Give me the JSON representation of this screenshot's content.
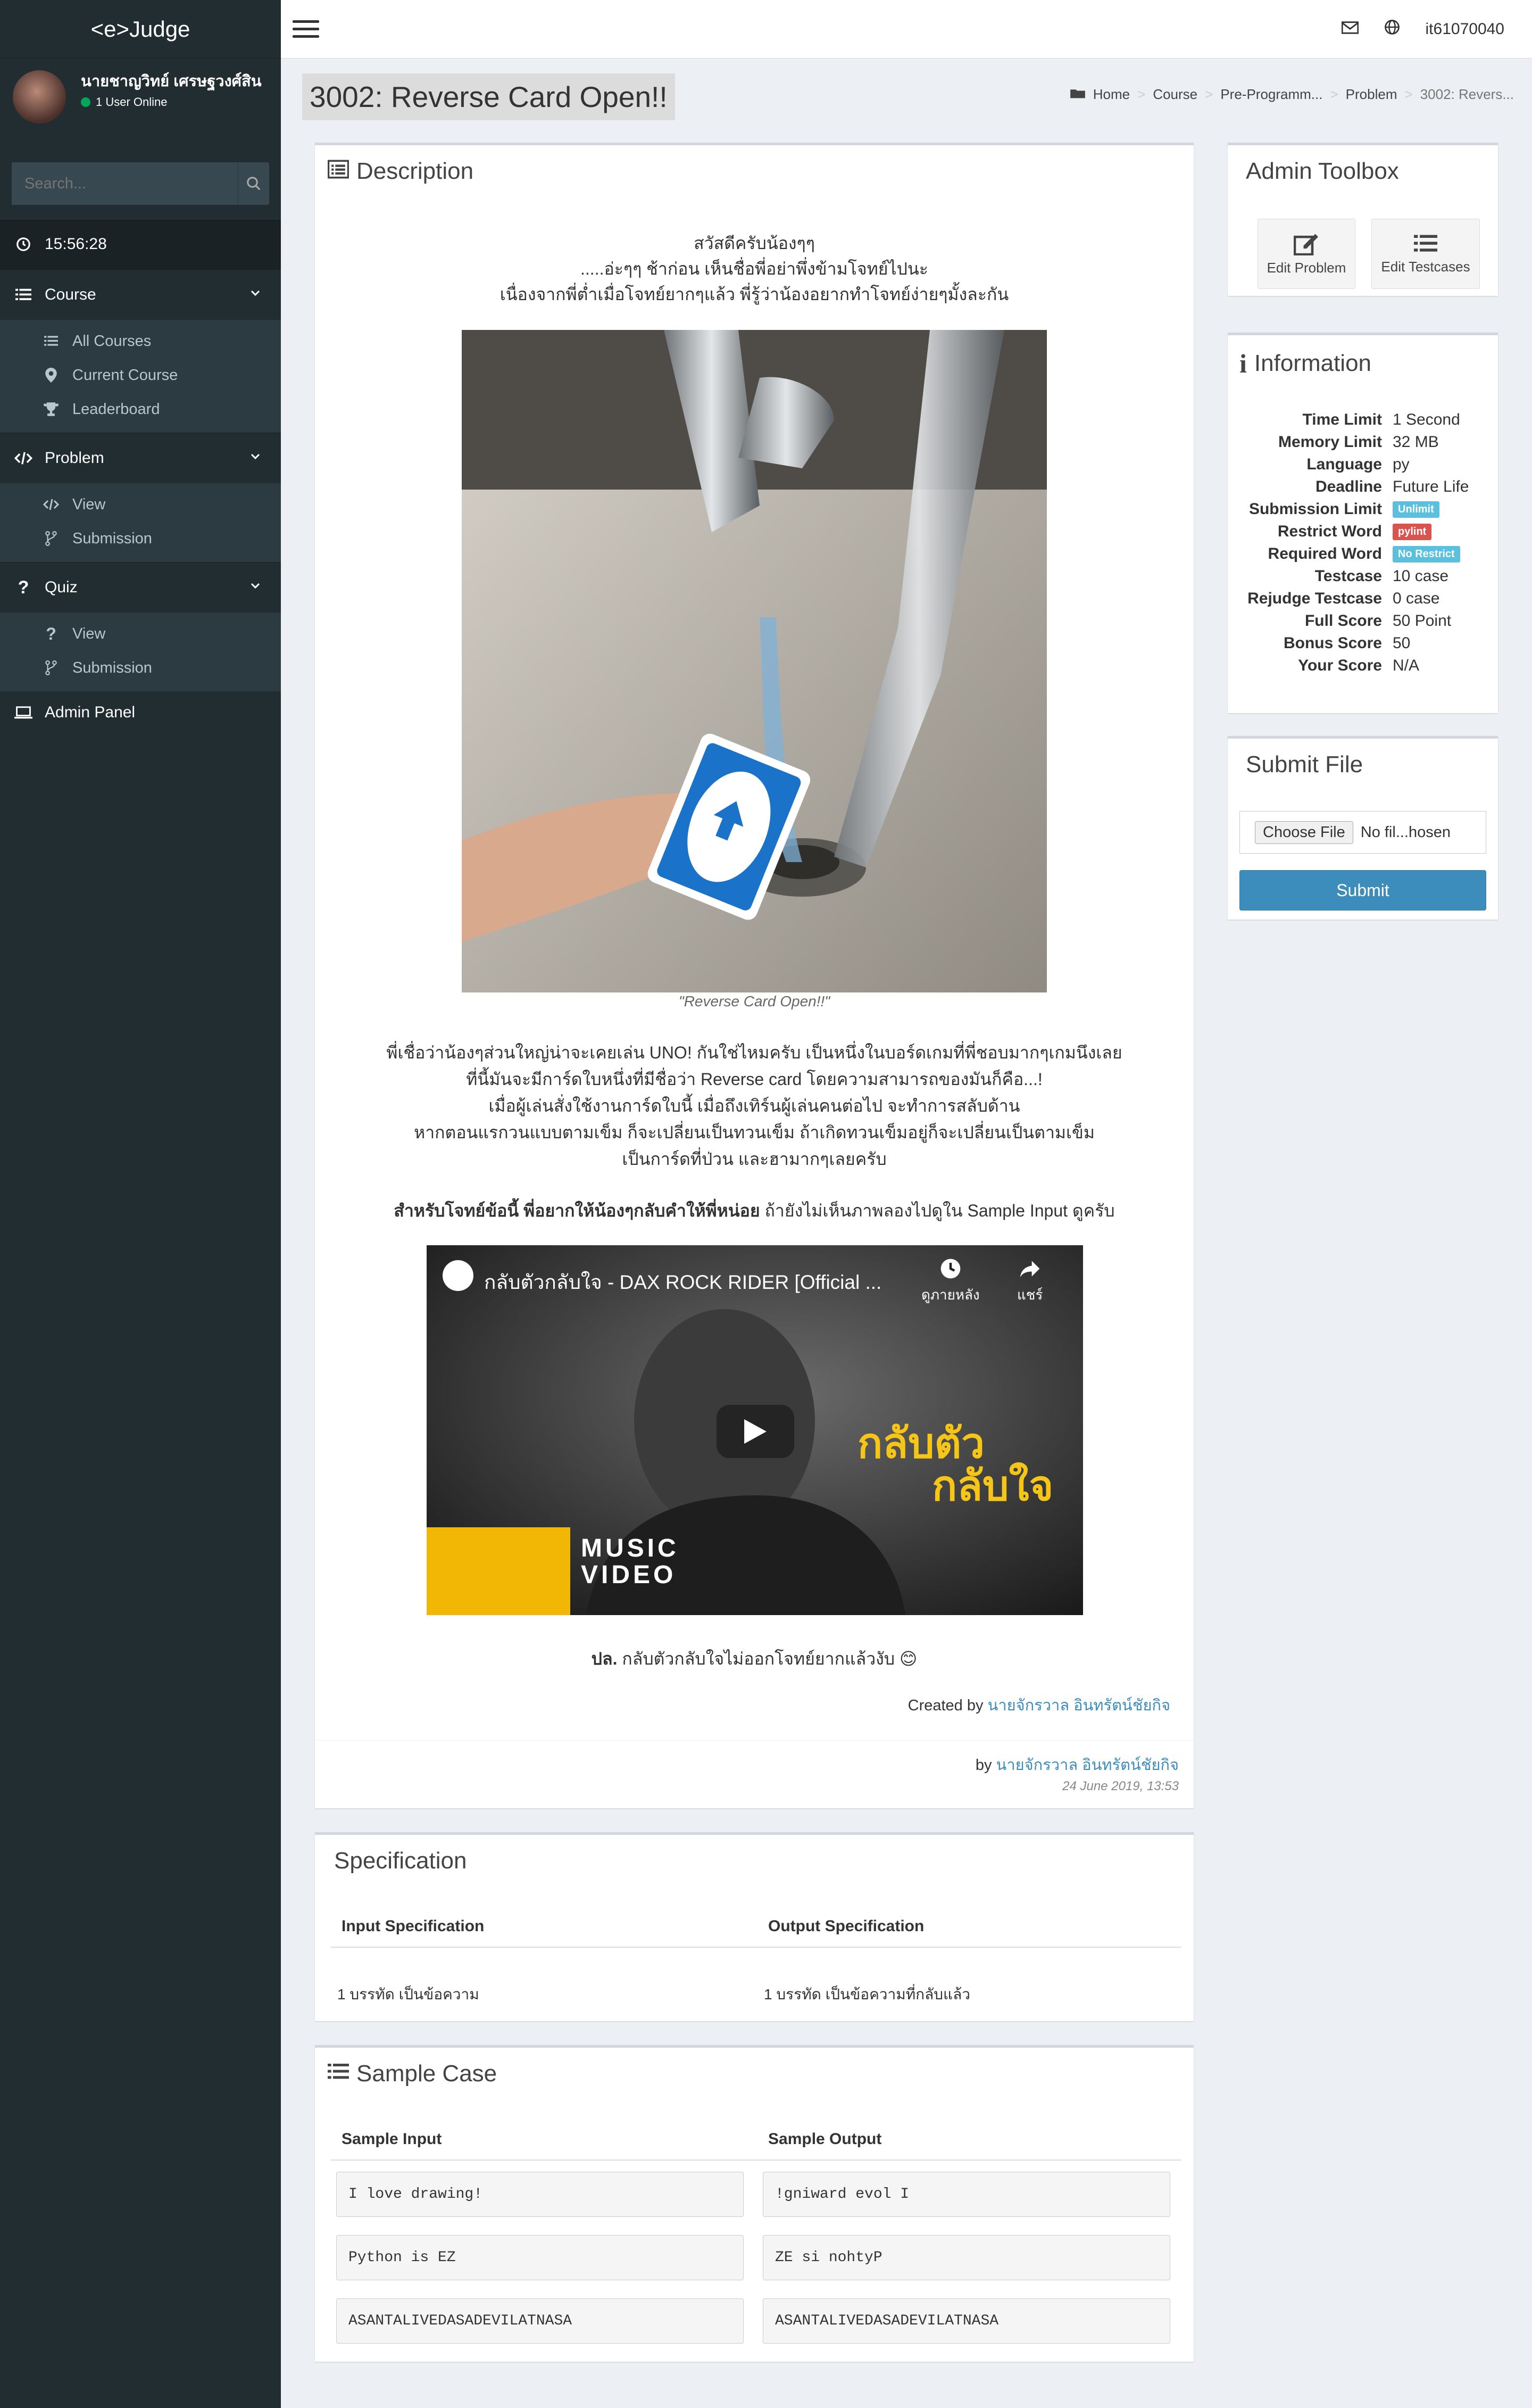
{
  "app": {
    "logo": "<e>Judge"
  },
  "user": {
    "name": "นายชาญวิทย์ เศรษฐวงศ์สิน",
    "online_text": "1 User Online",
    "top_username": "it61070040"
  },
  "search": {
    "placeholder": "Search..."
  },
  "sidebar": {
    "clock": "15:56:28",
    "course": {
      "label": "Course",
      "items": [
        "All Courses",
        "Current Course",
        "Leaderboard"
      ]
    },
    "problem": {
      "label": "Problem",
      "items": [
        "View",
        "Submission"
      ]
    },
    "quiz": {
      "label": "Quiz",
      "items": [
        "View",
        "Submission"
      ]
    },
    "admin": "Admin Panel"
  },
  "page": {
    "title": "3002: Reverse Card Open!!",
    "breadcrumb": [
      "Home",
      "Course",
      "Pre-Programm...",
      "Problem",
      "3002: Revers..."
    ]
  },
  "description": {
    "title": "Description",
    "intro": [
      "สวัสดีครับน้องๆๆ",
      ".....อ่ะๆๆ ช้าก่อน เห็นชื่อพี่อย่าพึ่งข้ามโจทย์ไปนะ",
      "เนื่องจากพี่ต่ำเมื่อโจทย์ยากๆแล้ว พี่รู้ว่าน้องอยากทำโจทย์ง่ายๆมั้งละกัน"
    ],
    "image_caption": "\"Reverse Card Open!!\"",
    "body": [
      "พี่เชื่อว่าน้องๆส่วนใหญ่น่าจะเคยเล่น UNO! กันใช่ไหมครับ เป็นหนึ่งในบอร์ดเกมที่พี่ชอบมากๆเกมนึงเลย",
      "ที่นี้มันจะมีการ์ดใบหนึ่งที่มีชื่อว่า Reverse card โดยความสามารถของมันก็คือ...!",
      "เมื่อผู้เล่นสั่งใช้งานการ์ดใบนี้ เมื่อถึงเทิร์นผู้เล่นคนต่อไป จะทำการสลับด้าน",
      "หากตอนแรกวนแบบตามเข็ม ก็จะเปลี่ยนเป็นทวนเข็ม ถ้าเกิดทวนเข็มอยู่ก็จะเปลี่ยนเป็นตามเข็ม",
      "เป็นการ์ดที่ป่วน และฮามากๆเลยครับ"
    ],
    "task_bold": "สำหรับโจทย์ข้อนี้ พี่อยากให้น้องๆกลับคำให้พี่หน่อย",
    "task_rest": " ถ้ายังไม่เห็นภาพลองไปดูใน Sample Input ดูครับ",
    "video": {
      "title": "กลับตัวกลับใจ - DAX ROCK RIDER [Official ...",
      "watch_later": "ดูภายหลัง",
      "share": "แชร์",
      "badge_line1": "MUSIC",
      "badge_line2": "VIDEO",
      "overlay_text_1": "กลับตัว",
      "overlay_text_2": "กลับใจ"
    },
    "ps_bold": "ปล.",
    "ps_rest": " กลับตัวกลับใจไม่ออกโจทย์ยากแล้วงับ 😊",
    "created_prefix": "Created by ",
    "created_name": "นายจักรวาล อินทรัตน์ชัยกิจ",
    "by_prefix": "by ",
    "by_name": "นายจักรวาล อินทรัตน์ชัยกิจ",
    "date": "24 June 2019, 13:53"
  },
  "toolbox": {
    "title": "Admin Toolbox",
    "edit_problem": "Edit Problem",
    "edit_testcases": "Edit Testcases"
  },
  "information": {
    "title": "Information",
    "rows": [
      {
        "k": "Time Limit",
        "v": "1 Second"
      },
      {
        "k": "Memory Limit",
        "v": "32 MB"
      },
      {
        "k": "Language",
        "v": "py"
      },
      {
        "k": "Deadline",
        "v": "Future Life"
      },
      {
        "k": "Submission Limit",
        "v": "Unlimit",
        "badge": "#5bc0de"
      },
      {
        "k": "Restrict Word",
        "v": "pylint",
        "badge": "#d9534f"
      },
      {
        "k": "Required Word",
        "v": "No Restrict",
        "badge": "#5bc0de"
      },
      {
        "k": "Testcase",
        "v": "10 case"
      },
      {
        "k": "Rejudge Testcase",
        "v": "0 case"
      },
      {
        "k": "Full Score",
        "v": "50 Point"
      },
      {
        "k": "Bonus Score",
        "v": "50"
      },
      {
        "k": "Your Score",
        "v": "N/A"
      }
    ]
  },
  "submit": {
    "title": "Submit File",
    "choose": "Choose File",
    "no_file": "No fil...hosen",
    "button": "Submit",
    "button_color": "#3c8dbc"
  },
  "specification": {
    "title": "Specification",
    "input_head": "Input Specification",
    "output_head": "Output Specification",
    "input_val": "1 บรรทัด เป็นข้อความ",
    "output_val": "1 บรรทัด เป็นข้อความที่กลับแล้ว"
  },
  "sample": {
    "title": "Sample Case",
    "input_head": "Sample Input",
    "output_head": "Sample Output",
    "inputs": [
      "I love drawing!",
      "Python is EZ",
      "ASANTALIVEDASADEVILATNASA"
    ],
    "outputs": [
      "!gniward evol I",
      "ZE si nohtyP",
      "ASANTALIVEDASADEVILATNASA"
    ]
  }
}
